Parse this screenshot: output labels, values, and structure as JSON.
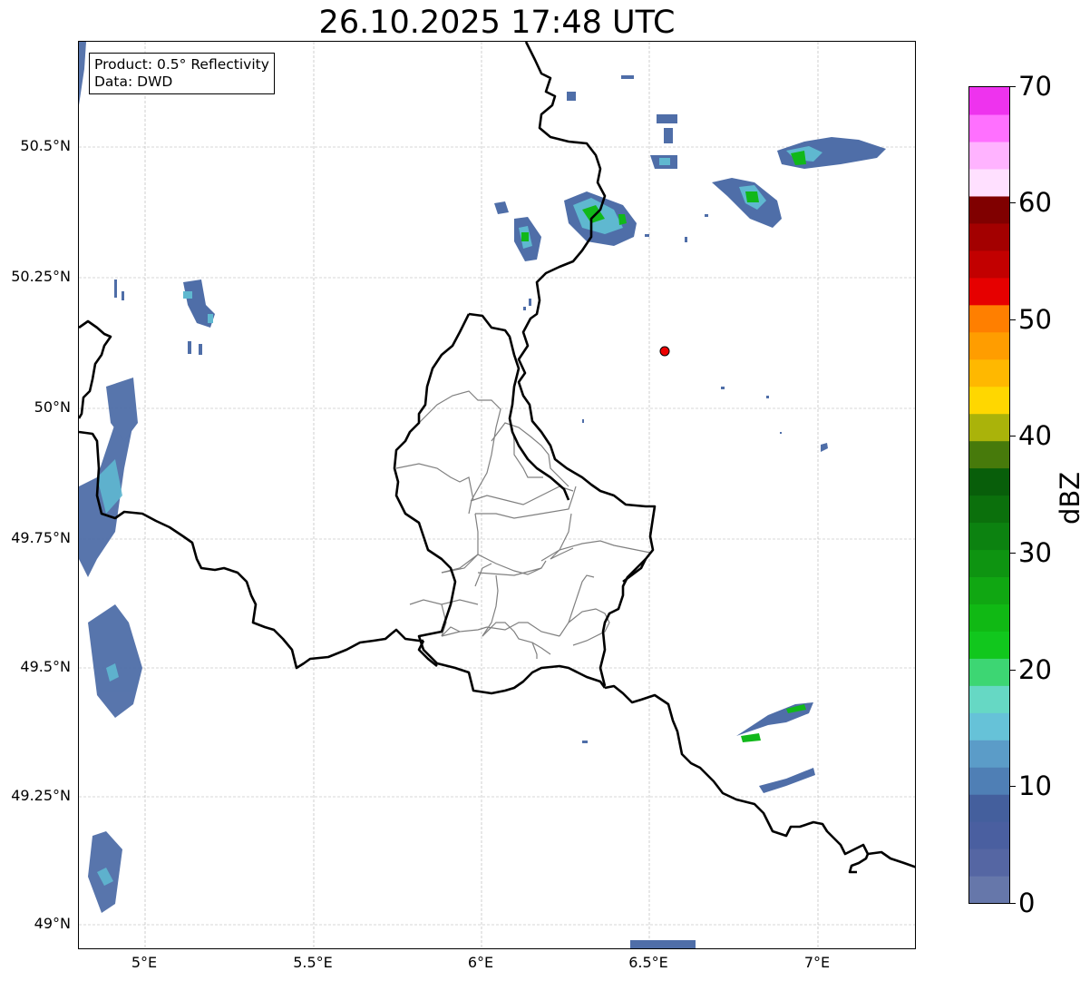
{
  "title": "26.10.2025 17:48 UTC",
  "infobox": {
    "product": "Product: 0.5° Reflectivity",
    "data": "Data: DWD"
  },
  "axes": {
    "x_ticks": [
      "5°E",
      "5.5°E",
      "6°E",
      "6.5°E",
      "7°E"
    ],
    "y_ticks": [
      "50.5°N",
      "50.25°N",
      "50°N",
      "49.75°N",
      "49.5°N",
      "49.25°N",
      "49°N"
    ]
  },
  "colorbar": {
    "label": "dBZ",
    "ticks": [
      "0",
      "10",
      "20",
      "30",
      "40",
      "50",
      "60",
      "70"
    ],
    "colors": [
      "#6677aa",
      "#5566a3",
      "#4a5fa0",
      "#445f9d",
      "#4f7fb5",
      "#5b9cc8",
      "#66c2d8",
      "#66d8c4",
      "#3dd673",
      "#11c71d",
      "#10b914",
      "#10a712",
      "#0e9411",
      "#0c8210",
      "#0b700c",
      "#085e0a",
      "#477a0b",
      "#aab30a",
      "#ffd700",
      "#ffb800",
      "#ff9d00",
      "#ff7f00",
      "#e60000",
      "#c20000",
      "#a30000",
      "#800000",
      "#ffe0ff",
      "#ffb3ff",
      "#ff70ff",
      "#ee33ee"
    ]
  },
  "marker": {
    "lon": 6.55,
    "lat": 50.11,
    "color": "#ee0000"
  },
  "map_colors": {
    "border": "#000000",
    "canton": "#808080",
    "grid": "#b0b0b0",
    "echo_low": "#4f6ea8",
    "echo_mid": "#5fb8d0",
    "echo_high": "#11b81a"
  }
}
